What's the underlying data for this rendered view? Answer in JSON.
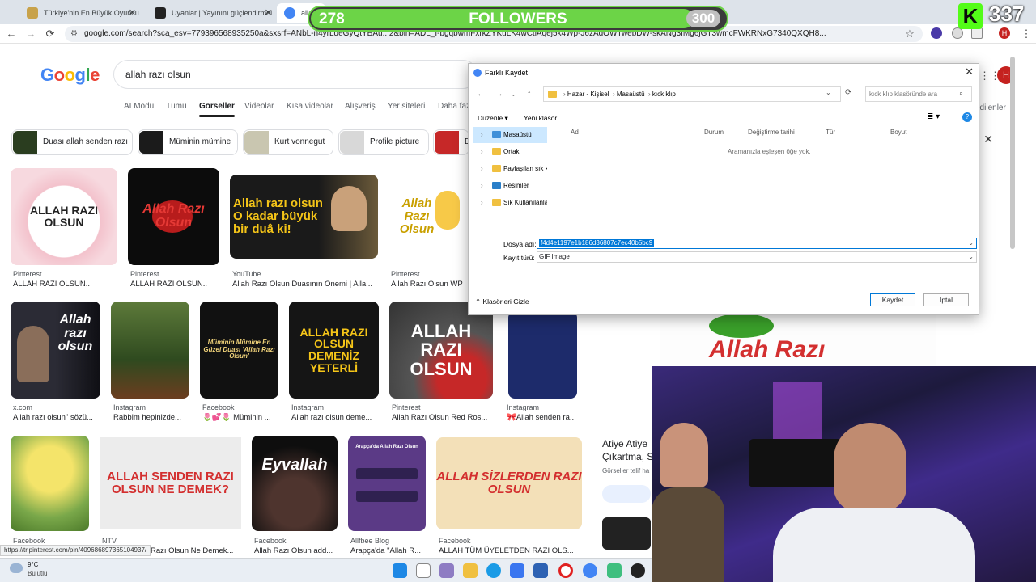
{
  "browser": {
    "tabs": [
      {
        "label": "Türkiye'nin En Büyük Oyuncu D",
        "color": "#8a6d3b"
      },
      {
        "label": "Uyanlar | Yayınını güçlendirmei",
        "color": "#333"
      },
      {
        "label": "allah",
        "color": "#4285f4"
      }
    ],
    "url": "google.com/search?sca_esv=779396568935250a&sxsrf=ANbL-n4yrLdeGyQtYBAu...2&bih=ADL_I-bgqbwmFxrkZYKuLK4wCtlAqej5k4Wp-J6zAdOWTwebDW-skANg3fMg6jGT3wmcFWKRNxG7340QXQH8...",
    "profile_initial": "H",
    "status_url": "https://tr.pinterest.com/pin/409686897365104937/"
  },
  "stream": {
    "followers_current": "278",
    "followers_label": "FOLLOWERS",
    "followers_goal": "300",
    "progress": 0.927,
    "kick_logo": "K",
    "kick_count": "337"
  },
  "google": {
    "logo": "Google",
    "query": "allah razı olsun",
    "tabs": [
      "AI Modu",
      "Tümü",
      "Görseller",
      "Videolar",
      "Kısa videolar",
      "Alışveriş",
      "Yer siteleri",
      "Daha faz"
    ],
    "active_tab": "Görseller",
    "right_link": "edilenler",
    "chips": [
      "Duası allah senden razı",
      "Müminin mümine",
      "Kurt vonnegut",
      "Profile picture",
      "D"
    ],
    "results": [
      {
        "source": "Pinterest",
        "title": "ALLAH RAZI OLSUN..",
        "overlay": "ALLAH RAZI OLSUN"
      },
      {
        "source": "Pinterest",
        "title": "ALLAH RAZI OLSUN..",
        "overlay": "Allah Razı Olsun"
      },
      {
        "source": "YouTube",
        "title": "Allah Razı Olsun Duasının Önemi | Alla...",
        "overlay": "Allah razı olsun O kadar büyük bir duâ ki!"
      },
      {
        "source": "Pinterest",
        "title": "Allah Razı Olsun WP",
        "overlay": "Allah Razı Olsun"
      },
      {
        "source": "x.com",
        "title": "Allah razı olsun\" sözü...",
        "overlay": "Allah razı olsun"
      },
      {
        "source": "Instagram",
        "title": "Rabbim hepinizde...",
        "overlay": ""
      },
      {
        "source": "Facebook",
        "title": "🌷💕🌷 Müminin ...",
        "overlay": "Müminin Mümine En Güzel Duası 'Allah Razı Olsun'"
      },
      {
        "source": "Instagram",
        "title": "Allah razı olsun deme...",
        "overlay": "ALLAH RAZI OLSUN DEMENİZ YETERLİ"
      },
      {
        "source": "Pinterest",
        "title": "Allah Razı Olsun Red Ros...",
        "overlay": "ALLAH RAZI OLSUN"
      },
      {
        "source": "Instagram",
        "title": "🎀Allah senden ra...",
        "overlay": ""
      },
      {
        "source": "Facebook",
        "title": "",
        "overlay": ""
      },
      {
        "source": "NTV",
        "title": "Razı Olsun Ne Demek...",
        "overlay": "ALLAH SENDEN RAZI OLSUN NE DEMEK?"
      },
      {
        "source": "Facebook",
        "title": "Allah Razı Olsun add...",
        "overlay": "Eyvallah"
      },
      {
        "source": "Allfbee Blog",
        "title": "Arapça'da \"Allah R...",
        "overlay": "Arapça'da Allah Razı Olsun"
      },
      {
        "source": "Facebook",
        "title": "ALLAH TÜM ÜYELETDEN RAZI OLS...",
        "overlay": "ALLAH SİZLERDEN RAZI OLSUN"
      }
    ],
    "panel": {
      "title_1": "Atiye Atiye",
      "title_2": "Çıkartma, S",
      "subtitle": "Görseller telif ha",
      "preview_text": "Allah Razı"
    }
  },
  "dialog": {
    "title": "Farklı Kaydet",
    "path": [
      "Hazar - Kişisel",
      "Masaüstü",
      "kıck klıp"
    ],
    "search_placeholder": "kıck klıp klasöründe ara",
    "organize": "Düzenle",
    "new_folder": "Yeni klasör",
    "tree": [
      "Masaüstü",
      "Ortak",
      "Paylaşılan sık k",
      "Resimler",
      "Sık Kullanılanla"
    ],
    "columns": [
      "Ad",
      "Durum",
      "Değiştirme tarihi",
      "Tür",
      "Boyut"
    ],
    "empty_text": "Aramanızla eşleşen öğe yok.",
    "filename_label": "Dosya adı:",
    "filename_value": "f4d4e1197e1b186d36807c7ec40b5bc9",
    "type_label": "Kayıt türü:",
    "type_value": "GIF Image",
    "hide_folders": "Klasörleri Gizle",
    "save": "Kaydet",
    "cancel": "İptal"
  },
  "taskbar": {
    "temp": "9°C",
    "weather": "Bulutlu"
  }
}
